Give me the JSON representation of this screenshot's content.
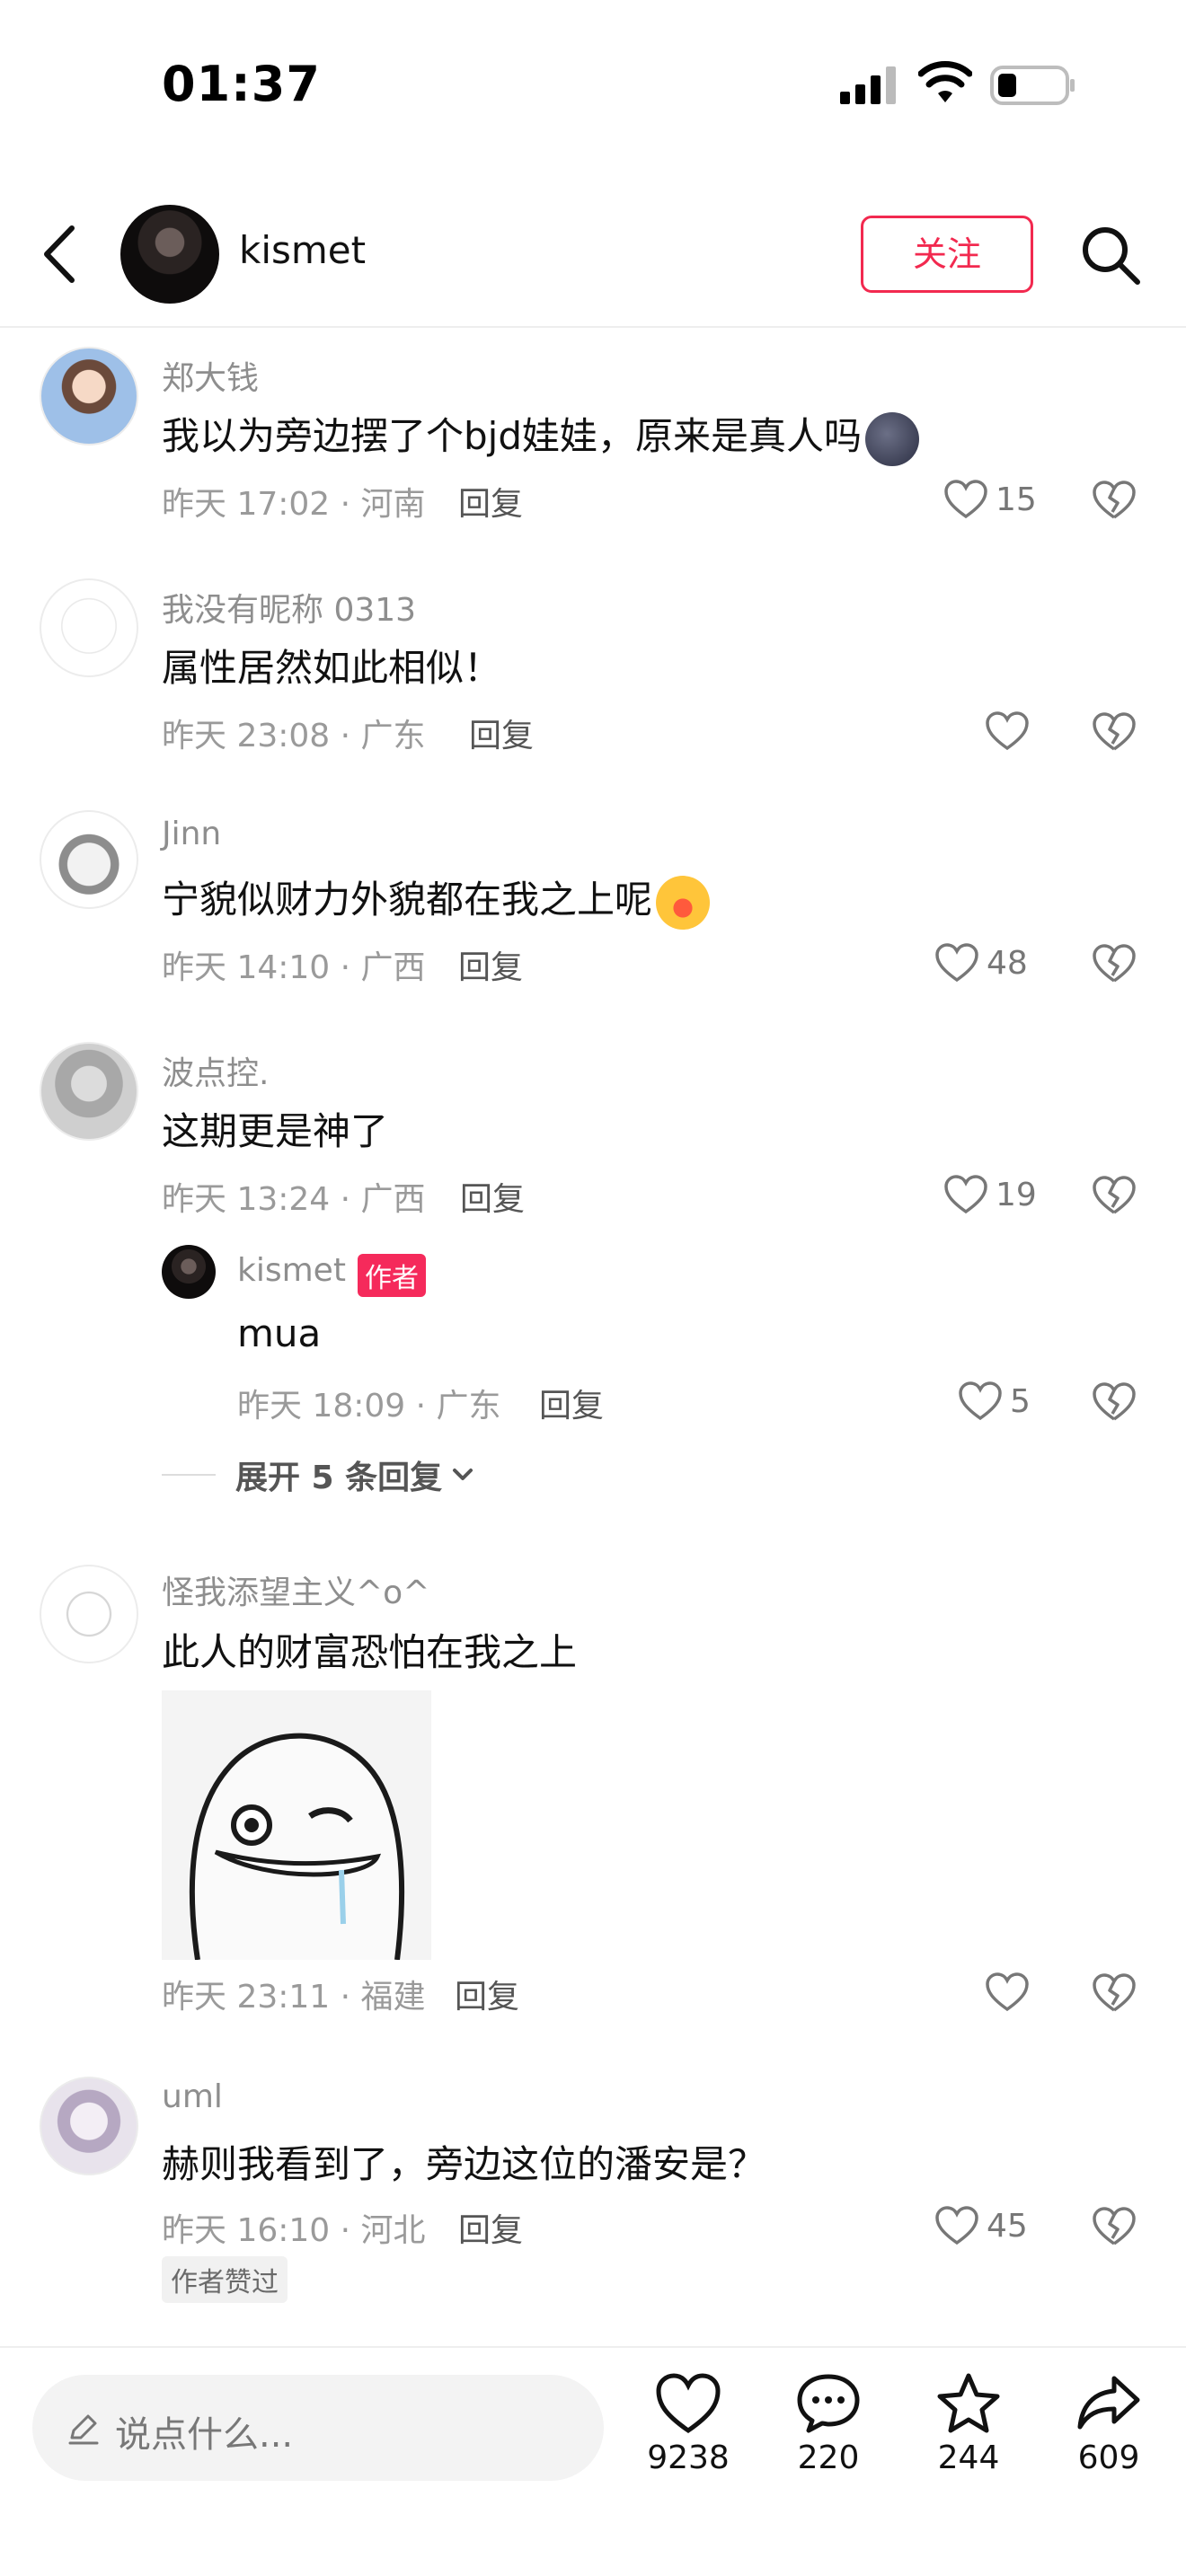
{
  "status_bar": {
    "time": "01:37"
  },
  "header": {
    "username": "kismet",
    "follow_label": "关注"
  },
  "comments": [
    {
      "name": "郑大钱",
      "text": "我以为旁边摆了个bjd娃娃，原来是真人吗",
      "meta": "昨天 17:02 · 河南",
      "reply": "回复",
      "likes": "15"
    },
    {
      "name": "我没有昵称 0313",
      "text": "属性居然如此相似！",
      "meta": "昨天 23:08 · 广东",
      "reply": "回复",
      "likes": ""
    },
    {
      "name": "Jinn",
      "text": "宁貌似财力外貌都在我之上呢",
      "meta": "昨天 14:10 · 广西",
      "reply": "回复",
      "likes": "48"
    },
    {
      "name": "波点控.",
      "text": "这期更是神了",
      "meta": "昨天 13:24 · 广西",
      "reply": "回复",
      "likes": "19"
    },
    {
      "name": "怪我添望主义^o^",
      "text": "此人的财富恐怕在我之上",
      "meta": "昨天 23:11 · 福建",
      "reply": "回复",
      "likes": ""
    },
    {
      "name": "uml",
      "text": "赫则我看到了，旁边这位的潘安是？",
      "meta": "昨天 16:10 · 河北",
      "reply": "回复",
      "likes": "45",
      "tag": "作者赞过"
    }
  ],
  "sub_reply": {
    "name": "kismet",
    "badge": "作者",
    "text": "mua",
    "meta": "昨天 18:09 · 广东",
    "reply": "回复",
    "likes": "5"
  },
  "expand_label": "展开 5 条回复",
  "bottom_bar": {
    "placeholder": "说点什么...",
    "like_count": "9238",
    "comment_count": "220",
    "star_count": "244",
    "share_count": "609"
  },
  "colors": {
    "accent": "#f2294f",
    "badge": "#f52a5b"
  }
}
